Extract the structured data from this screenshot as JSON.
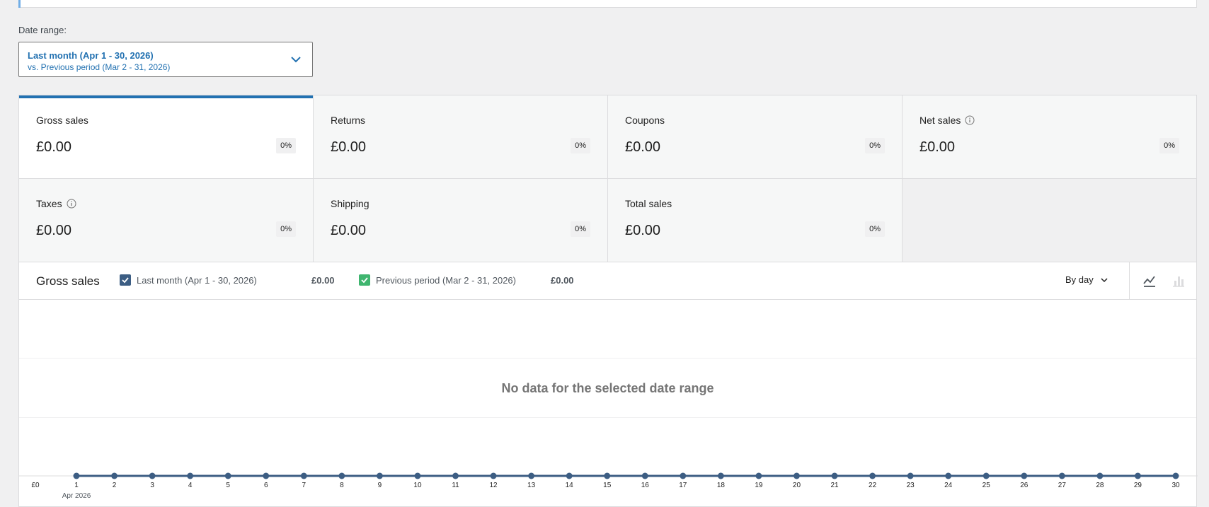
{
  "date_range": {
    "label": "Date range:",
    "primary": "Last month (Apr 1 - 30, 2026)",
    "secondary": "vs. Previous period (Mar 2 - 31, 2026)"
  },
  "summary": [
    {
      "label": "Gross sales",
      "value": "£0.00",
      "delta": "0%",
      "info": false,
      "selected": true
    },
    {
      "label": "Returns",
      "value": "£0.00",
      "delta": "0%",
      "info": false,
      "selected": false
    },
    {
      "label": "Coupons",
      "value": "£0.00",
      "delta": "0%",
      "info": false,
      "selected": false
    },
    {
      "label": "Net sales",
      "value": "£0.00",
      "delta": "0%",
      "info": true,
      "selected": false
    },
    {
      "label": "Taxes",
      "value": "£0.00",
      "delta": "0%",
      "info": true,
      "selected": false
    },
    {
      "label": "Shipping",
      "value": "£0.00",
      "delta": "0%",
      "info": false,
      "selected": false
    },
    {
      "label": "Total sales",
      "value": "£0.00",
      "delta": "0%",
      "info": false,
      "selected": false
    }
  ],
  "chart": {
    "title": "Gross sales",
    "legend": [
      {
        "label": "Last month (Apr 1 - 30, 2026)",
        "total": "£0.00",
        "color": "#3c5d83"
      },
      {
        "label": "Previous period (Mar 2 - 31, 2026)",
        "total": "£0.00",
        "color": "#3fb56f"
      }
    ],
    "interval": "By day",
    "chart_type_buttons": [
      "line-chart-icon",
      "bar-chart-icon"
    ],
    "empty_message": "No data for the selected date range",
    "y_tick": "£0",
    "x_ticks": [
      "1",
      "2",
      "3",
      "4",
      "5",
      "6",
      "7",
      "8",
      "9",
      "10",
      "11",
      "12",
      "13",
      "14",
      "15",
      "16",
      "17",
      "18",
      "19",
      "20",
      "21",
      "22",
      "23",
      "24",
      "25",
      "26",
      "27",
      "28",
      "29",
      "30"
    ],
    "x_sublabel": "Apr 2026",
    "line_color": "#3c5d83"
  },
  "chart_data": {
    "type": "line",
    "x": [
      "1",
      "2",
      "3",
      "4",
      "5",
      "6",
      "7",
      "8",
      "9",
      "10",
      "11",
      "12",
      "13",
      "14",
      "15",
      "16",
      "17",
      "18",
      "19",
      "20",
      "21",
      "22",
      "23",
      "24",
      "25",
      "26",
      "27",
      "28",
      "29",
      "30"
    ],
    "series": [
      {
        "name": "Last month (Apr 1 - 30, 2026)",
        "values": [
          0,
          0,
          0,
          0,
          0,
          0,
          0,
          0,
          0,
          0,
          0,
          0,
          0,
          0,
          0,
          0,
          0,
          0,
          0,
          0,
          0,
          0,
          0,
          0,
          0,
          0,
          0,
          0,
          0,
          0
        ]
      }
    ],
    "title": "Gross sales",
    "xlabel": "Apr 2026",
    "ylabel": "",
    "ylim": [
      0,
      0
    ],
    "grid": true,
    "legend": "top"
  }
}
